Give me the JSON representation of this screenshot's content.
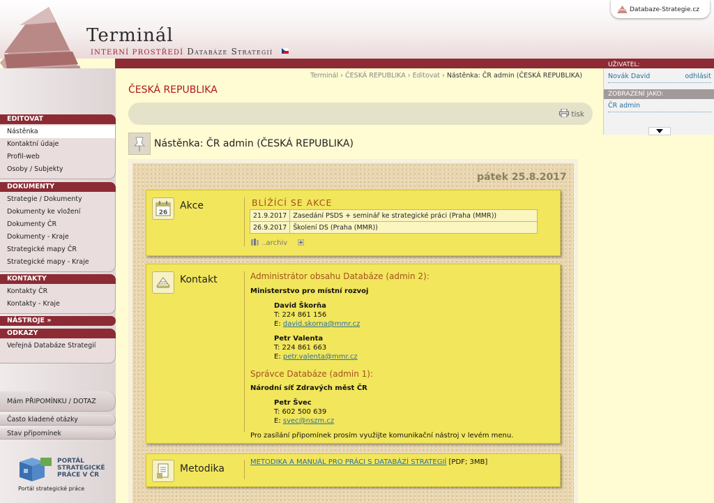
{
  "header": {
    "title": "Terminál",
    "subtitle_prefix": "interní prostředí",
    "subtitle_suffix": "Databáze Strategií",
    "db_link": "Databaze-Strategie.cz"
  },
  "breadcrumb": {
    "items": [
      "Terminál",
      "ČESKÁ REPUBLIKA",
      "Editovat"
    ],
    "separator": "›",
    "current": "Nástěnka: ČR admin (ČESKÁ REPUBLIKA)"
  },
  "page": {
    "title": "ČESKÁ REPUBLIKA",
    "print_label": "tisk",
    "board_title": "Nástěnka: ČR admin (ČESKÁ REPUBLIKA)",
    "date": "pátek 25.8.2017"
  },
  "sidebar": {
    "editovat": {
      "head": "EDITOVAT",
      "items": [
        "Nástěnka",
        "Kontaktní údaje",
        "Profil-web",
        "Osoby / Subjekty"
      ]
    },
    "dokumenty": {
      "head": "DOKUMENTY",
      "items": [
        "Strategie / Dokumenty",
        "Dokumenty ke vložení",
        "Dokumenty ČR",
        "Dokumenty - Kraje",
        "Strategické mapy ČR",
        "Strategické mapy - Kraje"
      ]
    },
    "kontakty": {
      "head": "KONTAKTY",
      "items": [
        "Kontakty ČR",
        "Kontakty - Kraje"
      ]
    },
    "nastroje": {
      "head": "NÁSTROJE »"
    },
    "odkazy": {
      "head": "ODKAZY",
      "items": [
        "Veřejná Databáze Strategií"
      ]
    },
    "buttons": {
      "feedback": "Mám PŘIPOMÍNKU / DOTAZ",
      "faq": "Často kladené otázky",
      "status": "Stav připomínek"
    },
    "portal": {
      "title_1": "PORTÁL",
      "title_2": "STRATEGICKÉ",
      "title_3": "PRÁCE V ČR",
      "caption": "Portál strategické práce"
    }
  },
  "user_panel": {
    "user_head": "UŽIVATEL:",
    "user_name": "Novák David",
    "logout": "odhlásit",
    "view_head": "ZOBRAZENÍ JAKO:",
    "view_value": "ČR admin"
  },
  "akce": {
    "label": "Akce",
    "calendar_day": "26",
    "events_title": "BLÍŽÍCÍ SE AKCE",
    "events": [
      {
        "date": "21.9.2017",
        "text": "Zasedání PSDS + seminář ke strategické práci (Praha (MMR))"
      },
      {
        "date": "26.9.2017",
        "text": "Školení DS (Praha (MMR))"
      }
    ],
    "archive": "..archiv"
  },
  "kontakt": {
    "label": "Kontakt",
    "admin2_title": "Administrátor obsahu Databáze (admin 2):",
    "admin2_org": "Ministerstvo pro místní rozvoj",
    "person1": {
      "name": "David Škorňa",
      "phone": "T: 224 861 156",
      "email_prefix": "E:",
      "email": "david.skorna@mmr.cz"
    },
    "person2": {
      "name": "Petr Valenta",
      "phone": "T: 224 861 663",
      "email_prefix": "E:",
      "email": "petr.valenta@mmr.cz"
    },
    "admin1_title": "Správce Databáze (admin 1):",
    "admin1_org": "Národní síť Zdravých měst ČR",
    "person3": {
      "name": "Petr Švec",
      "phone": "T: 602 500 639",
      "email_prefix": "E:",
      "email": "svec@nszm.cz"
    },
    "note": "Pro zasílání připomínek prosím využijte komunikační nástroj v levém menu."
  },
  "metodika": {
    "label": "Metodika",
    "link": "METODIKA A MANUÁL PRO PRÁCI S DATABÁZÍ STRATEGIÍ",
    "suffix": "[PDF; 3MB]"
  }
}
